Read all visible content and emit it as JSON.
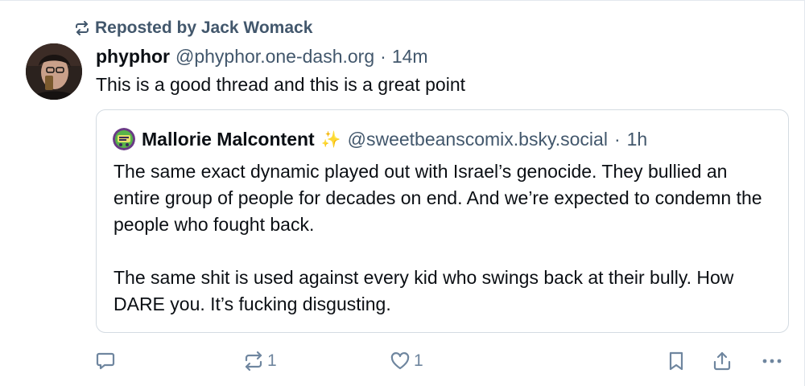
{
  "repost": {
    "icon": "repost-icon",
    "label": "Reposted by Jack Womack"
  },
  "post": {
    "author_name": "phyphor",
    "author_handle": "@phyphor.one-dash.org",
    "separator": "·",
    "time": "14m",
    "text": "This is a good thread and this is a great point"
  },
  "quote": {
    "author_name": "Mallorie Malcontent",
    "author_emoji": "✨",
    "author_handle": "@sweetbeanscomix.bsky.social",
    "separator": "·",
    "time": "1h",
    "paragraphs": [
      "The same exact dynamic played out with Israel’s genocide. They bullied an entire group of people for decades on end. And we’re expected to condemn the people who fought back.",
      "The same shit is used against every kid who swings back at their bully. How DARE you. It’s fucking disgusting."
    ]
  },
  "actions": {
    "reply_icon": "reply-icon",
    "repost_icon": "repost-icon",
    "repost_count": "1",
    "like_icon": "heart-icon",
    "like_count": "1",
    "bookmark_icon": "bookmark-icon",
    "share_icon": "share-icon",
    "more_icon": "more-icon"
  },
  "colors": {
    "text": "#0b0f14",
    "muted": "#42576c",
    "icon": "#6f869f",
    "border": "#d4dbe2"
  }
}
